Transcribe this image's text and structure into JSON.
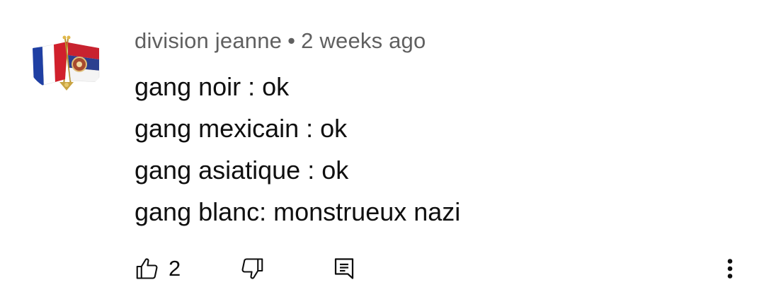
{
  "comment": {
    "author": "division jeanne",
    "separator": "•",
    "time": "2 weeks ago",
    "lines": [
      "gang noir : ok",
      "gang mexicain : ok",
      "gang asiatique : ok",
      "gang blanc: monstrueux nazi"
    ],
    "likes": "2"
  },
  "icons": {
    "avatar": "crossed-flags-pin-icon",
    "like": "thumbs-up-icon",
    "dislike": "thumbs-down-icon",
    "reply": "reply-comment-icon",
    "more": "more-vertical-icon"
  },
  "colors": {
    "meta_text": "#606060",
    "body_text": "#0f0f0f",
    "background": "#ffffff"
  }
}
